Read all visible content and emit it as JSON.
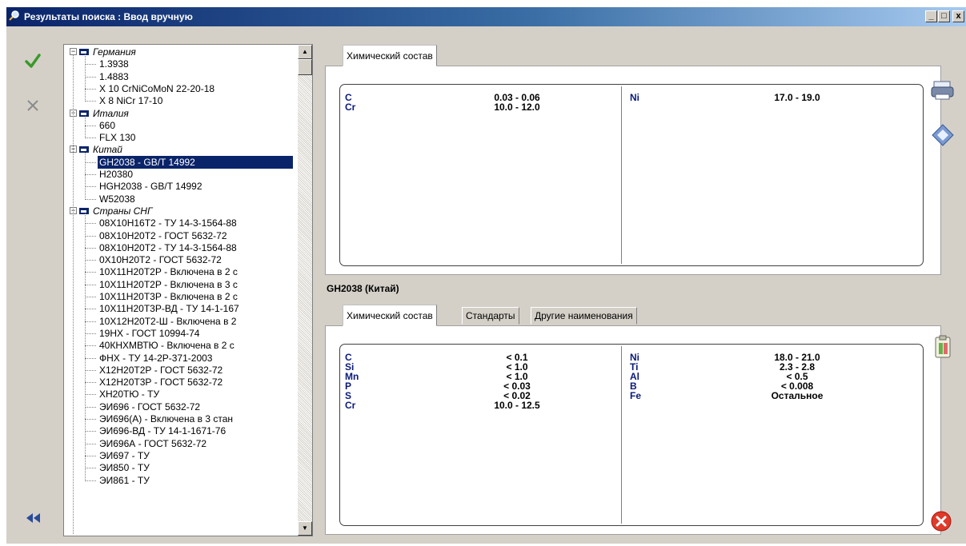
{
  "window": {
    "title": "Результаты поиска : Ввод вручную"
  },
  "tree": {
    "groups": [
      {
        "name": "Германия",
        "items": [
          "1.3938",
          "1.4883",
          "X 10 CrNiCoMoN 22-20-18",
          "X 8 NiCr 17-10"
        ]
      },
      {
        "name": "Италия",
        "items": [
          "660",
          "FLX 130"
        ]
      },
      {
        "name": "Китай",
        "items": [
          "GH2038  -  GB/T 14992",
          "H20380",
          "HGH2038  -  GB/T 14992",
          "W52038"
        ]
      },
      {
        "name": "Страны СНГ",
        "items": [
          "08Х10Н16Т2  -  ТУ 14-3-1564-88",
          "08Х10Н20Т2  -  ГОСТ 5632-72",
          "08Х10Н20Т2  -  ТУ 14-3-1564-88",
          "0Х10Н20Т2  -  ГОСТ 5632-72",
          "10Х11Н20Т2Р  -  Включена в 2 с",
          "10Х11Н20Т2Р  -  Включена в 3 с",
          "10Х11Н20Т3Р  -  Включена в 2 с",
          "10Х11Н20Т3Р-ВД  -  ТУ 14-1-167",
          "10Х12Н20Т2-Ш  -  Включена в 2",
          "19НХ  -  ГОСТ 10994-74",
          "40КНХМВТЮ  -  Включена в 2 с",
          "ФНХ  -  ТУ 14-2Р-371-2003",
          "Х12Н20Т2Р  -  ГОСТ 5632-72",
          "Х12Н20Т3Р  -  ГОСТ 5632-72",
          "ХН20ТЮ  -  ТУ",
          "ЭИ696  -  ГОСТ 5632-72",
          "ЭИ696(А)  -  Включена в 3 стан",
          "ЭИ696-ВД  -  ТУ 14-1-1671-76",
          "ЭИ696А  -  ГОСТ 5632-72",
          "ЭИ697  -  ТУ",
          "ЭИ850  -  ТУ",
          "ЭИ861  -  ТУ"
        ]
      }
    ],
    "selected": "GH2038  -  GB/T 14992"
  },
  "top_panel": {
    "tab": "Химический состав",
    "left": [
      {
        "el": "C",
        "val": "0.03 - 0.06"
      },
      {
        "el": "Cr",
        "val": "10.0 - 12.0"
      }
    ],
    "right": [
      {
        "el": "Ni",
        "val": "17.0 - 19.0"
      }
    ]
  },
  "material_label": "GH2038 (Китай)",
  "bottom_panel": {
    "tabs": [
      "Химический состав",
      "Стандарты",
      "Другие наименования"
    ],
    "left": [
      {
        "el": "C",
        "val": "< 0.1"
      },
      {
        "el": "Si",
        "val": "< 1.0"
      },
      {
        "el": "Mn",
        "val": "< 1.0"
      },
      {
        "el": "P",
        "val": "< 0.03"
      },
      {
        "el": "S",
        "val": "< 0.02"
      },
      {
        "el": "Cr",
        "val": "10.0 - 12.5"
      }
    ],
    "right": [
      {
        "el": "Ni",
        "val": "18.0 - 21.0"
      },
      {
        "el": "Ti",
        "val": "2.3 - 2.8"
      },
      {
        "el": "Al",
        "val": "< 0.5"
      },
      {
        "el": "B",
        "val": "< 0.008"
      },
      {
        "el": "Fe",
        "val": "Остальное"
      }
    ]
  },
  "icons": {
    "left_toolbar": [
      "check-icon",
      "cross-icon",
      "rewind-icon"
    ],
    "right_toolbar": [
      "printer-icon",
      "export-icon",
      "clipboard-icon",
      "close-icon"
    ]
  },
  "colors": {
    "titlebar": "#0a246a",
    "selection": "#0a246a",
    "element_text": "#0a1a7a"
  }
}
